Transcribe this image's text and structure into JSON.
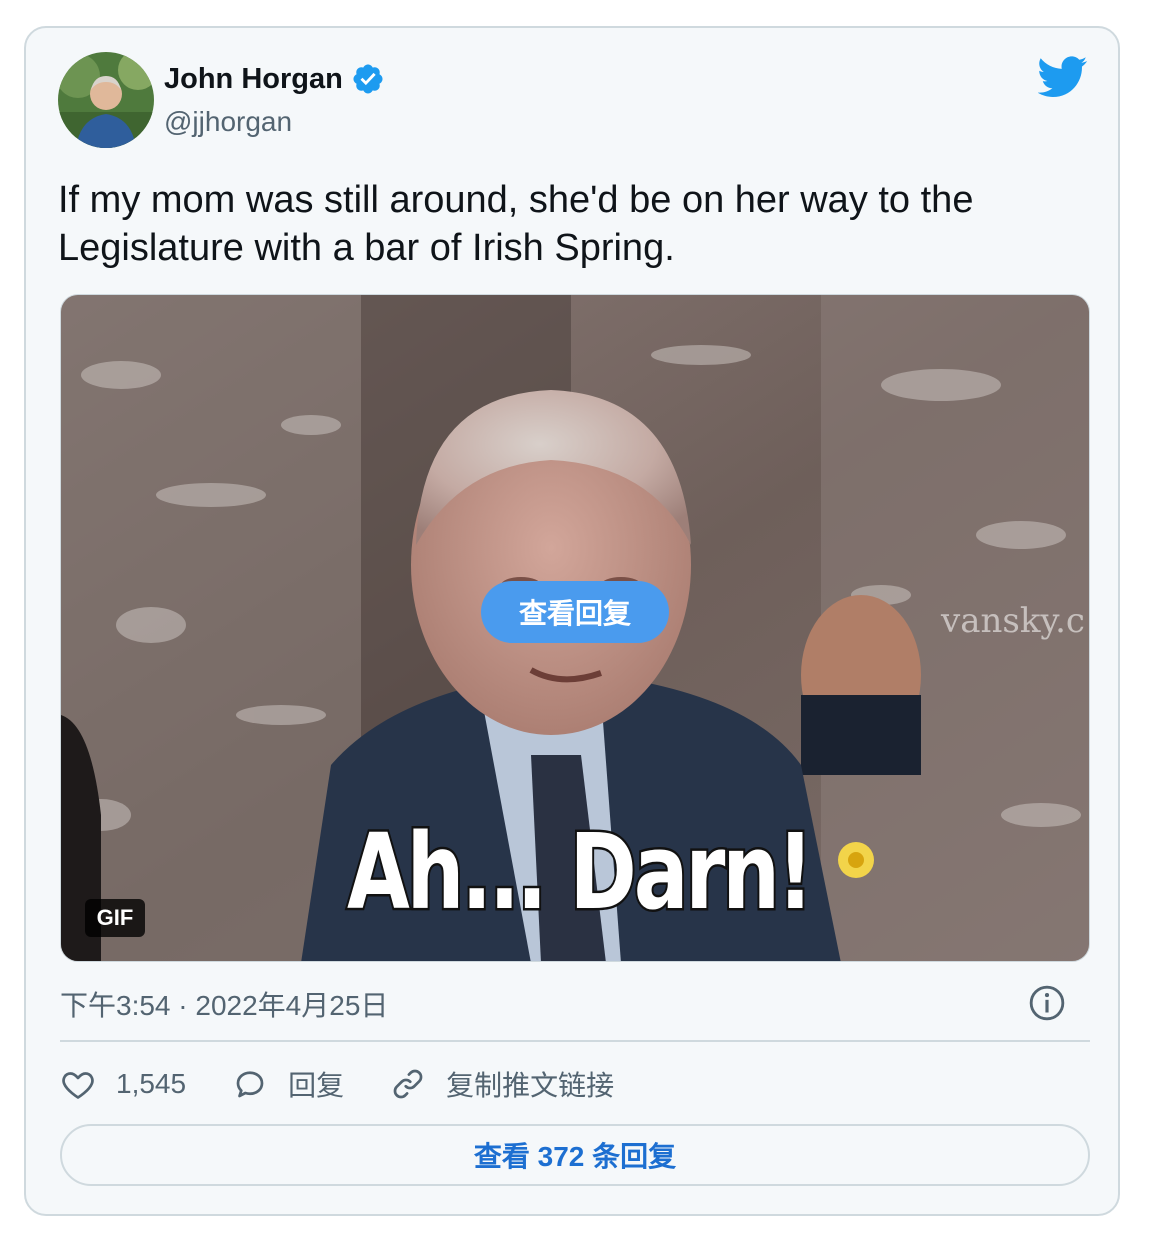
{
  "author": {
    "name": "John Horgan",
    "handle": "@jjhorgan",
    "verified": true
  },
  "tweet": {
    "text": "If my mom was still around, she'd be on her way to the Legislature with a bar of Irish Spring."
  },
  "media": {
    "caption": "Ah... Darn!",
    "badge": "GIF",
    "overlay_button": "查看回复",
    "watermark": "vansky.c"
  },
  "meta": {
    "timestamp": "下午3:54 · 2022年4月25日"
  },
  "actions": {
    "like_count": "1,545",
    "reply_label": "回复",
    "copy_link_label": "复制推文链接"
  },
  "footer": {
    "view_replies_label": "查看 372 条回复"
  },
  "colors": {
    "twitter_blue": "#1d9bf0",
    "link_blue": "#1d6fd1",
    "muted": "#536471"
  },
  "icons": {
    "logo": "twitter-bird-icon",
    "verified": "verified-badge-icon",
    "info": "info-icon",
    "like": "heart-icon",
    "reply": "speech-bubble-icon",
    "copy": "link-icon"
  }
}
